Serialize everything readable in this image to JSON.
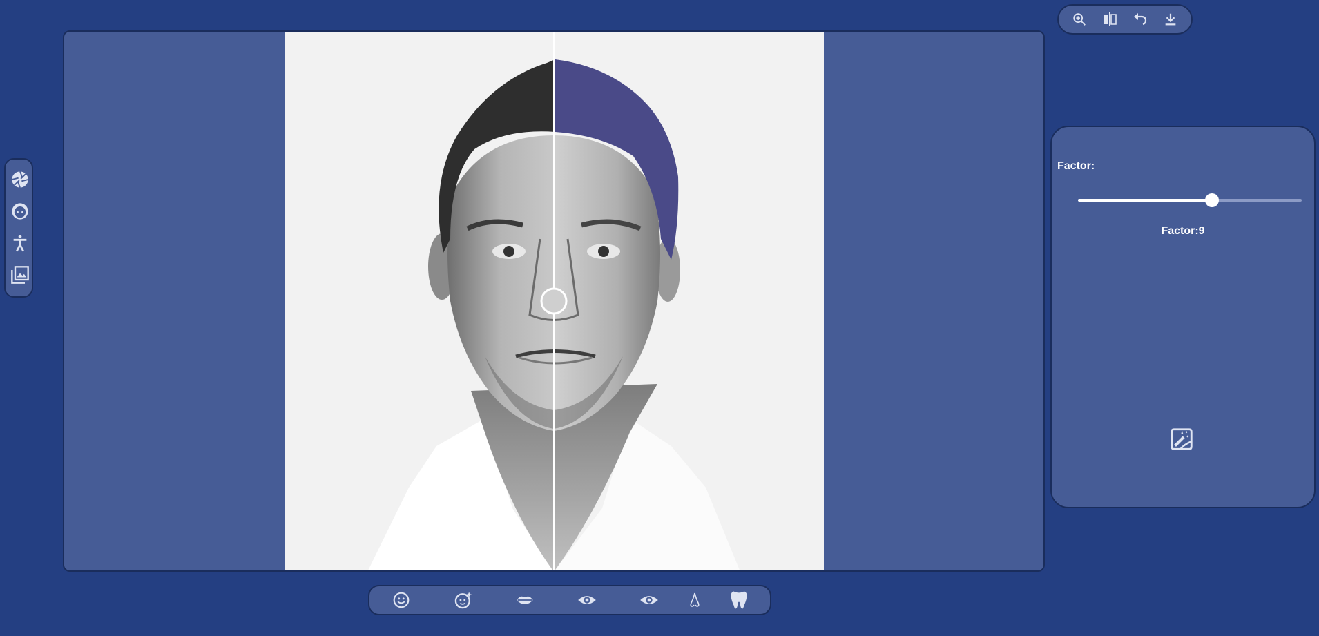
{
  "left_toolbar": {
    "items": [
      {
        "icon": "aperture-icon"
      },
      {
        "icon": "face-icon"
      },
      {
        "icon": "body-icon"
      },
      {
        "icon": "gallery-icon"
      }
    ]
  },
  "top_toolbar": {
    "items": [
      {
        "icon": "zoom-in-icon"
      },
      {
        "icon": "compare-icon"
      },
      {
        "icon": "undo-icon"
      },
      {
        "icon": "download-icon"
      }
    ]
  },
  "side_panel": {
    "factor_label": "Factor:",
    "factor_value_text": "Factor:9",
    "slider_fraction": 0.6
  },
  "bottom_toolbar": {
    "items": [
      {
        "icon": "smile-face-icon"
      },
      {
        "icon": "face-retouch-icon"
      },
      {
        "icon": "lips-icon"
      },
      {
        "icon": "eye-icon"
      },
      {
        "icon": "eye-icon"
      },
      {
        "icon": "nose-icon"
      },
      {
        "icon": "tooth-icon"
      }
    ]
  },
  "colors": {
    "background": "#243f82",
    "panel": "#465c96",
    "hair_tint": "#4a4a88"
  },
  "canvas": {
    "image": "black-and-white portrait of a man with split before/after comparison slider"
  }
}
